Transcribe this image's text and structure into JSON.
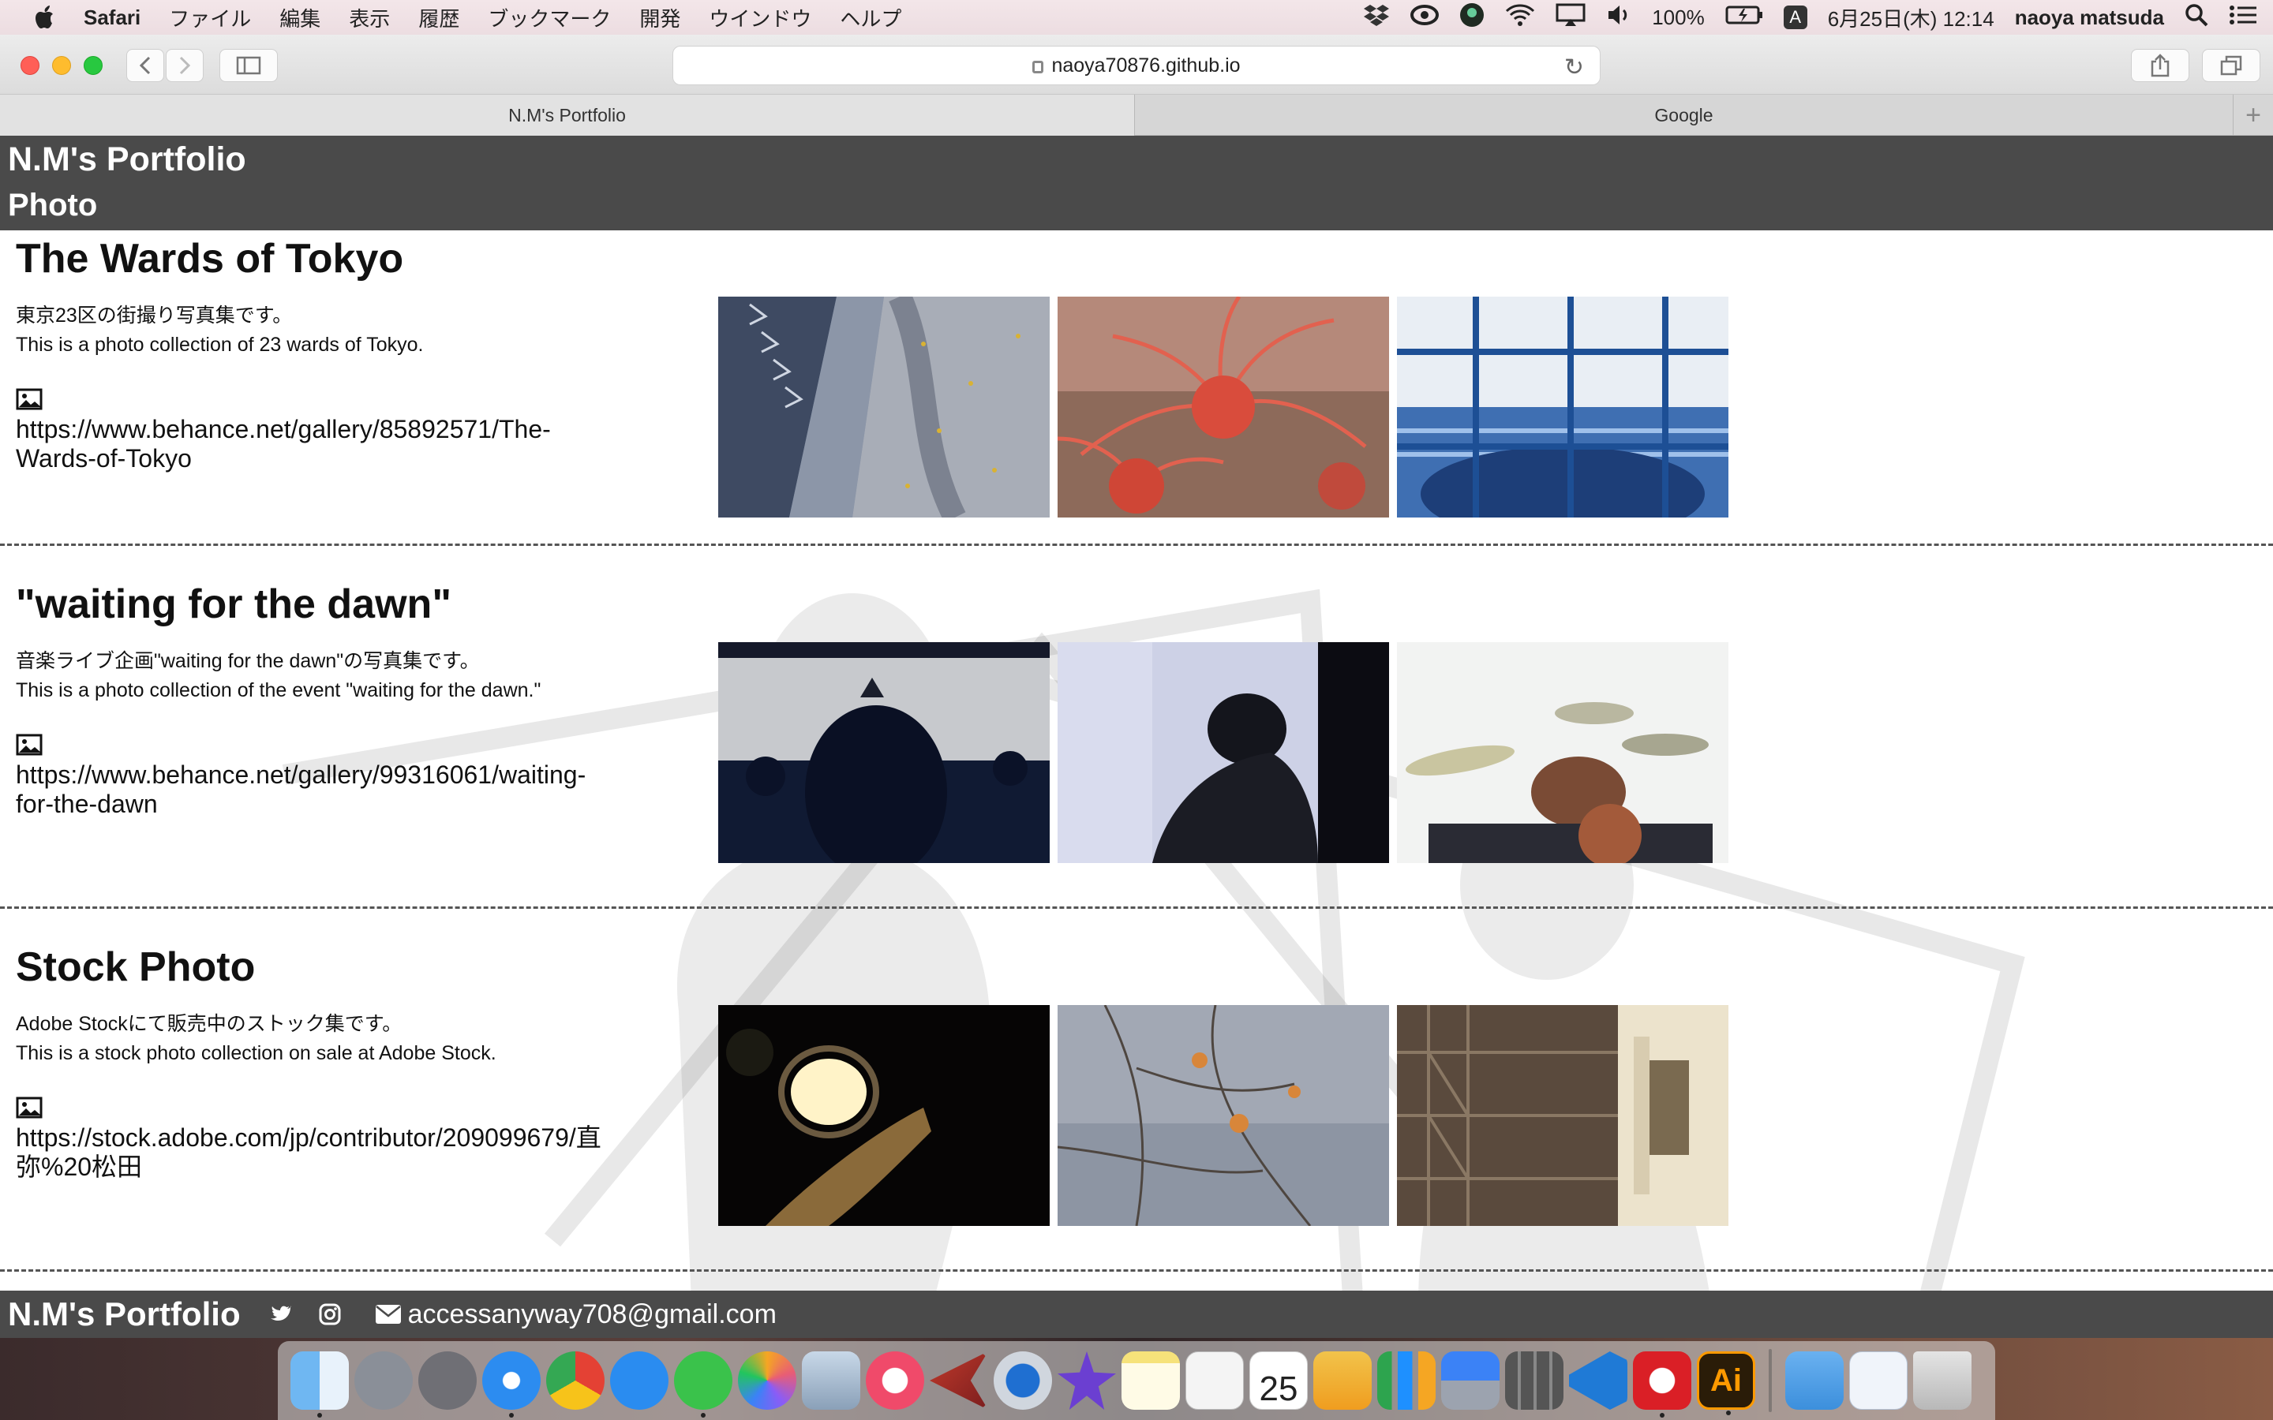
{
  "menubar": {
    "app_name": "Safari",
    "items": [
      "ファイル",
      "編集",
      "表示",
      "履歴",
      "ブックマーク",
      "開発",
      "ウインドウ",
      "ヘルプ"
    ],
    "battery": "100%",
    "input_source": "A",
    "datetime": "6月25日(木)  12:14",
    "user": "naoya matsuda"
  },
  "browser": {
    "url": "naoya70876.github.io",
    "tabs": [
      "N.M's Portfolio",
      "Google"
    ],
    "new_tab": "+"
  },
  "page": {
    "site_title": "N.M's Portfolio",
    "section_title": "Photo",
    "galleries": [
      {
        "title": "The Wards of Tokyo",
        "desc_ja": "東京23区の街撮り写真集です。",
        "desc_en": "This is a photo collection of 23 wards of Tokyo.",
        "link": "https://www.behance.net/gallery/85892571/The-Wards-of-Tokyo",
        "photos": [
          "street-wall-leaves",
          "red-spider-lily",
          "blue-water-treatment-fence"
        ]
      },
      {
        "title": "\"waiting for the dawn\"",
        "desc_ja": "音楽ライブ企画\"waiting for the dawn\"の写真集です。",
        "desc_en": "This is a photo collection of the event \"waiting for the dawn.\"",
        "link": "https://www.behance.net/gallery/99316061/waiting-for-the-dawn",
        "photos": [
          "live-stage-silhouette",
          "singer-looking-up",
          "drummer-cymbals"
        ]
      },
      {
        "title": "Stock Photo",
        "desc_ja": "Adobe Stockにて販売中のストック集です。",
        "desc_en": "This is a stock photo collection on sale at Adobe Stock.",
        "link": "https://stock.adobe.com/jp/contributor/209099679/直弥%20松田",
        "photos": [
          "night-street-lamp",
          "branches-reflection",
          "building-fire-escape"
        ]
      }
    ],
    "footer": {
      "title": "N.M's Portfolio",
      "email": "accessanyway708@gmail.com",
      "icons": [
        "twitter-icon",
        "instagram-icon",
        "mail-icon"
      ]
    }
  },
  "dock": {
    "apps": [
      "Finder",
      "Launchpad",
      "System Preferences",
      "Safari",
      "Chrome",
      "App Store",
      "LINE",
      "Photos",
      "Image Capture",
      "iTunes",
      "Sketch-like",
      "QuickTime",
      "iMovie",
      "Notes",
      "TextEdit",
      "Calendar",
      "Keynote Stickies",
      "Numbers",
      "Keynote",
      "Calculator",
      "VS Code",
      "Creative Cloud",
      "Illustrator",
      "Folder",
      "Documents",
      "Trash"
    ],
    "calendar_day": "25",
    "illustrator_label": "Ai"
  },
  "colors": {
    "header_bg": "#4a4a4a",
    "dock_bg": "#dcdcdc"
  }
}
